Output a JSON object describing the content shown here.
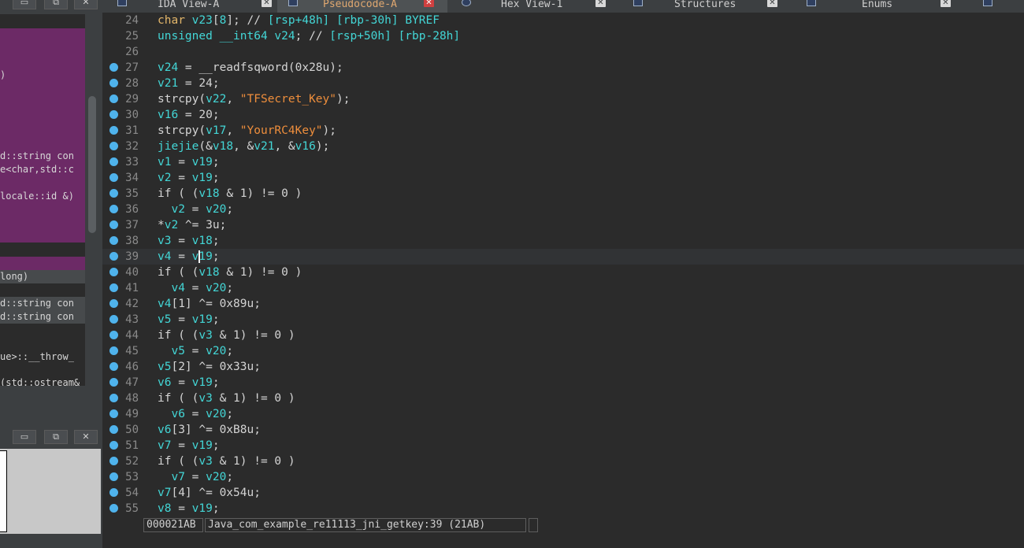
{
  "tabs": [
    {
      "label": "IDA View-A",
      "active": false,
      "icon": "disassembly-icon"
    },
    {
      "label": "Pseudocode-A",
      "active": true,
      "icon": "pseudocode-icon"
    },
    {
      "label": "Hex View-1",
      "active": false,
      "icon": "hex-icon"
    },
    {
      "label": "Structures",
      "active": false,
      "icon": "structures-icon"
    },
    {
      "label": "Enums",
      "active": false,
      "icon": "enums-icon"
    }
  ],
  "left_panel": {
    "window_buttons": [
      "restore",
      "float",
      "close"
    ],
    "function_rows": [
      {
        "text": ")",
        "style": "purple"
      },
      {
        "text": "d::string con",
        "style": "purple"
      },
      {
        "text": "e<char,std::c",
        "style": "purple"
      },
      {
        "text": "locale::id &)",
        "style": "purple"
      },
      {
        "text": "long)",
        "style": "gray"
      },
      {
        "text": "d::string con",
        "style": "gray"
      },
      {
        "text": "d::string con",
        "style": "gray"
      },
      {
        "text": "ue>::__throw_",
        "style": "dark"
      },
      {
        "text": "(std::ostream&",
        "style": "dark"
      }
    ]
  },
  "code": {
    "lines": [
      {
        "no": "24",
        "bp": false,
        "tokens": [
          [
            "t",
            "char"
          ],
          [
            "n",
            " "
          ],
          [
            "c",
            "v23"
          ],
          [
            "n",
            "["
          ],
          [
            "c",
            "8"
          ],
          [
            "n",
            "]; // "
          ],
          [
            "c",
            "[rsp+48h] [rbp-30h]"
          ],
          [
            "n",
            " "
          ],
          [
            "c",
            "BYREF"
          ]
        ]
      },
      {
        "no": "25",
        "bp": false,
        "tokens": [
          [
            "c",
            "unsigned __int64"
          ],
          [
            "n",
            " "
          ],
          [
            "c",
            "v24"
          ],
          [
            "n",
            "; // "
          ],
          [
            "c",
            "[rsp+50h] [rbp-28h]"
          ]
        ]
      },
      {
        "no": "26",
        "bp": false,
        "tokens": []
      },
      {
        "no": "27",
        "bp": true,
        "tokens": [
          [
            "c",
            "v24"
          ],
          [
            "n",
            " = __readfsqword("
          ],
          [
            "n",
            "0x28u"
          ],
          [
            "n",
            ");"
          ]
        ]
      },
      {
        "no": "28",
        "bp": true,
        "tokens": [
          [
            "c",
            "v21"
          ],
          [
            "n",
            " = "
          ],
          [
            "n",
            "24"
          ],
          [
            "n",
            ";"
          ]
        ]
      },
      {
        "no": "29",
        "bp": true,
        "tokens": [
          [
            "n",
            "strcpy("
          ],
          [
            "c",
            "v22"
          ],
          [
            "n",
            ", "
          ],
          [
            "s",
            "\"TFSecret_Key\""
          ],
          [
            "n",
            ");"
          ]
        ]
      },
      {
        "no": "30",
        "bp": true,
        "tokens": [
          [
            "c",
            "v16"
          ],
          [
            "n",
            " = "
          ],
          [
            "n",
            "20"
          ],
          [
            "n",
            ";"
          ]
        ]
      },
      {
        "no": "31",
        "bp": true,
        "tokens": [
          [
            "n",
            "strcpy("
          ],
          [
            "c",
            "v17"
          ],
          [
            "n",
            ", "
          ],
          [
            "s",
            "\"YourRC4Key\""
          ],
          [
            "n",
            ");"
          ]
        ]
      },
      {
        "no": "32",
        "bp": true,
        "tokens": [
          [
            "c",
            "jiejie"
          ],
          [
            "n",
            "(&"
          ],
          [
            "c",
            "v18"
          ],
          [
            "n",
            ", &"
          ],
          [
            "c",
            "v21"
          ],
          [
            "n",
            ", &"
          ],
          [
            "c",
            "v16"
          ],
          [
            "n",
            ");"
          ]
        ]
      },
      {
        "no": "33",
        "bp": true,
        "tokens": [
          [
            "c",
            "v1"
          ],
          [
            "n",
            " = "
          ],
          [
            "c",
            "v19"
          ],
          [
            "n",
            ";"
          ]
        ]
      },
      {
        "no": "34",
        "bp": true,
        "tokens": [
          [
            "c",
            "v2"
          ],
          [
            "n",
            " = "
          ],
          [
            "c",
            "v19"
          ],
          [
            "n",
            ";"
          ]
        ]
      },
      {
        "no": "35",
        "bp": true,
        "tokens": [
          [
            "n",
            "if ( ("
          ],
          [
            "c",
            "v18"
          ],
          [
            "n",
            " & 1) != 0 )"
          ]
        ]
      },
      {
        "no": "36",
        "bp": true,
        "tokens": [
          [
            "n",
            "  "
          ],
          [
            "c",
            "v2"
          ],
          [
            "n",
            " = "
          ],
          [
            "c",
            "v20"
          ],
          [
            "n",
            ";"
          ]
        ]
      },
      {
        "no": "37",
        "bp": true,
        "tokens": [
          [
            "n",
            "*"
          ],
          [
            "c",
            "v2"
          ],
          [
            "n",
            " ^= 3u;"
          ]
        ]
      },
      {
        "no": "38",
        "bp": true,
        "tokens": [
          [
            "c",
            "v3"
          ],
          [
            "n",
            " = "
          ],
          [
            "c",
            "v18"
          ],
          [
            "n",
            ";"
          ]
        ]
      },
      {
        "no": "39",
        "bp": true,
        "tokens": [
          [
            "c",
            "v4"
          ],
          [
            "n",
            " = "
          ],
          [
            "c",
            "v19"
          ],
          [
            "n",
            ";"
          ]
        ],
        "current": true
      },
      {
        "no": "40",
        "bp": true,
        "tokens": [
          [
            "n",
            "if ( ("
          ],
          [
            "c",
            "v18"
          ],
          [
            "n",
            " & 1) != 0 )"
          ]
        ]
      },
      {
        "no": "41",
        "bp": true,
        "tokens": [
          [
            "n",
            "  "
          ],
          [
            "c",
            "v4"
          ],
          [
            "n",
            " = "
          ],
          [
            "c",
            "v20"
          ],
          [
            "n",
            ";"
          ]
        ]
      },
      {
        "no": "42",
        "bp": true,
        "tokens": [
          [
            "c",
            "v4"
          ],
          [
            "n",
            "[1] ^= 0x89u;"
          ]
        ]
      },
      {
        "no": "43",
        "bp": true,
        "tokens": [
          [
            "c",
            "v5"
          ],
          [
            "n",
            " = "
          ],
          [
            "c",
            "v19"
          ],
          [
            "n",
            ";"
          ]
        ]
      },
      {
        "no": "44",
        "bp": true,
        "tokens": [
          [
            "n",
            "if ( ("
          ],
          [
            "c",
            "v3"
          ],
          [
            "n",
            " & 1) != 0 )"
          ]
        ]
      },
      {
        "no": "45",
        "bp": true,
        "tokens": [
          [
            "n",
            "  "
          ],
          [
            "c",
            "v5"
          ],
          [
            "n",
            " = "
          ],
          [
            "c",
            "v20"
          ],
          [
            "n",
            ";"
          ]
        ]
      },
      {
        "no": "46",
        "bp": true,
        "tokens": [
          [
            "c",
            "v5"
          ],
          [
            "n",
            "[2] ^= 0x33u;"
          ]
        ]
      },
      {
        "no": "47",
        "bp": true,
        "tokens": [
          [
            "c",
            "v6"
          ],
          [
            "n",
            " = "
          ],
          [
            "c",
            "v19"
          ],
          [
            "n",
            ";"
          ]
        ]
      },
      {
        "no": "48",
        "bp": true,
        "tokens": [
          [
            "n",
            "if ( ("
          ],
          [
            "c",
            "v3"
          ],
          [
            "n",
            " & 1) != 0 )"
          ]
        ]
      },
      {
        "no": "49",
        "bp": true,
        "tokens": [
          [
            "n",
            "  "
          ],
          [
            "c",
            "v6"
          ],
          [
            "n",
            " = "
          ],
          [
            "c",
            "v20"
          ],
          [
            "n",
            ";"
          ]
        ]
      },
      {
        "no": "50",
        "bp": true,
        "tokens": [
          [
            "c",
            "v6"
          ],
          [
            "n",
            "[3] ^= 0xB8u;"
          ]
        ]
      },
      {
        "no": "51",
        "bp": true,
        "tokens": [
          [
            "c",
            "v7"
          ],
          [
            "n",
            " = "
          ],
          [
            "c",
            "v19"
          ],
          [
            "n",
            ";"
          ]
        ]
      },
      {
        "no": "52",
        "bp": true,
        "tokens": [
          [
            "n",
            "if ( ("
          ],
          [
            "c",
            "v3"
          ],
          [
            "n",
            " & 1) != 0 )"
          ]
        ]
      },
      {
        "no": "53",
        "bp": true,
        "tokens": [
          [
            "n",
            "  "
          ],
          [
            "c",
            "v7"
          ],
          [
            "n",
            " = "
          ],
          [
            "c",
            "v20"
          ],
          [
            "n",
            ";"
          ]
        ]
      },
      {
        "no": "54",
        "bp": true,
        "tokens": [
          [
            "c",
            "v7"
          ],
          [
            "n",
            "[4] ^= 0x54u;"
          ]
        ]
      },
      {
        "no": "55",
        "bp": true,
        "tokens": [
          [
            "c",
            "v8"
          ],
          [
            "n",
            " = "
          ],
          [
            "c",
            "v19"
          ],
          [
            "n",
            ";"
          ]
        ]
      }
    ]
  },
  "status": {
    "address": "000021AB",
    "location": "Java_com_example_re11113_jni_getkey:39 (21AB)",
    "extra": ""
  },
  "colors": {
    "background": "#2b2b2b",
    "identifier": "#43d6d6",
    "string": "#ee8e3c",
    "breakpoint": "#4fb3ec",
    "selected_function": "#6c2a66"
  }
}
